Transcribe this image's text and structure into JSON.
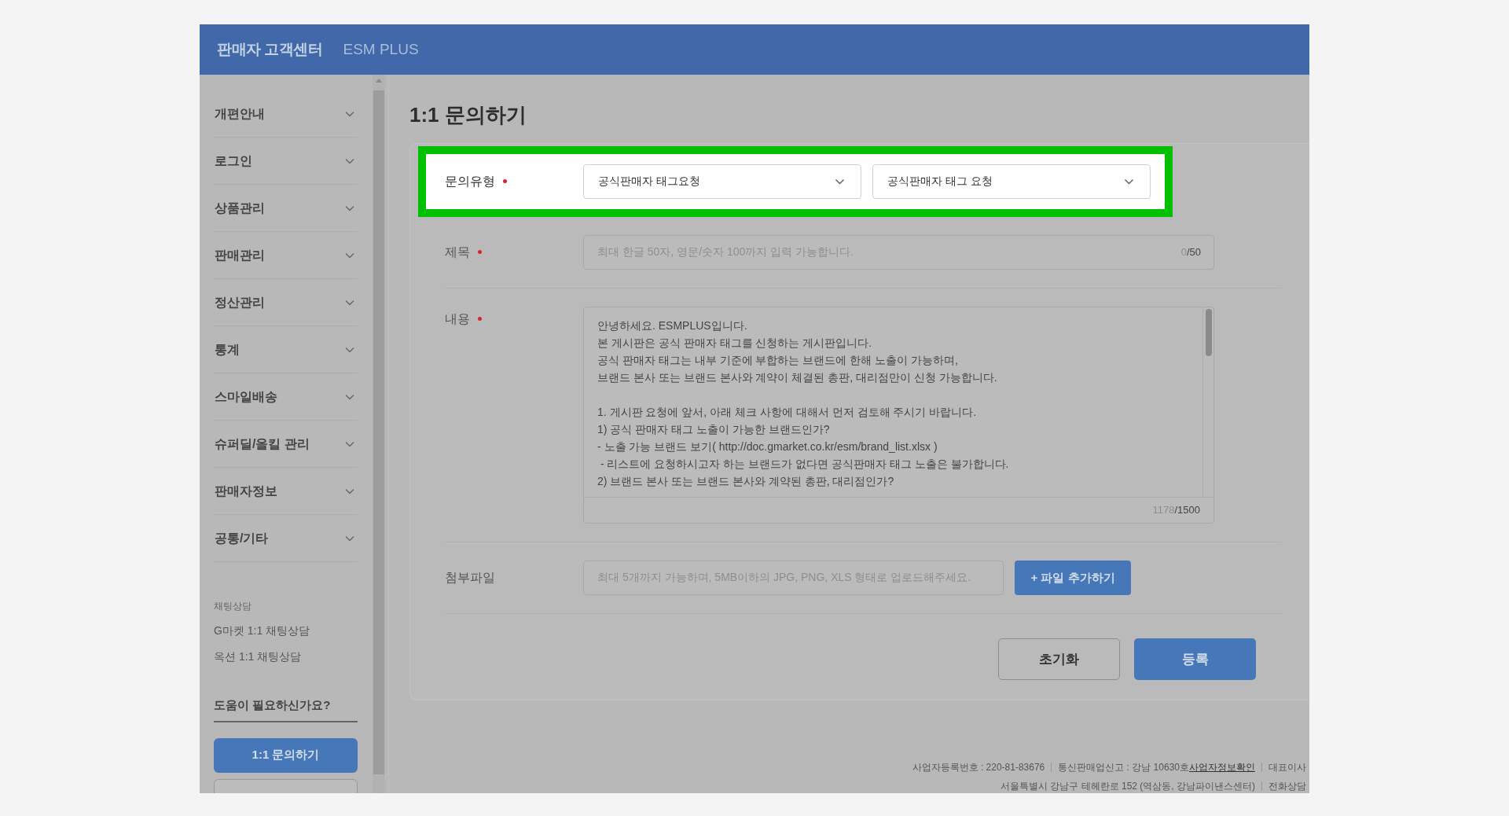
{
  "header": {
    "title": "판매자 고객센터",
    "brand": "ESM PLUS"
  },
  "sidebar": {
    "items": [
      {
        "label": "개편안내",
        "expanded": false
      },
      {
        "label": "로그인",
        "expanded": false
      },
      {
        "label": "상품관리",
        "expanded": false
      },
      {
        "label": "판매관리",
        "expanded": false
      },
      {
        "label": "정산관리",
        "expanded": false
      },
      {
        "label": "통계",
        "expanded": false
      },
      {
        "label": "스마일배송",
        "expanded": false
      },
      {
        "label": "슈퍼딜/올킬 관리",
        "expanded": false
      },
      {
        "label": "판매자정보",
        "expanded": false
      },
      {
        "label": "공통/기타",
        "expanded": false
      }
    ],
    "chat_title": "채팅상담",
    "chat_links": [
      "G마켓 1:1 채팅상담",
      "옥션 1:1 채팅상담"
    ],
    "help_title": "도움이 필요하신가요?",
    "buttons": [
      {
        "label": "1:1 문의하기",
        "selected": true
      }
    ]
  },
  "page_title": "1:1 문의하기",
  "form": [
    {
      "kind": "select",
      "label": "문의유형",
      "required": true,
      "highlighted": true,
      "values": [
        "공식판매자 태그요청",
        "공식판매자 태그 요청"
      ]
    },
    {
      "kind": "text",
      "label": "제목",
      "required": true,
      "highlighted": false,
      "placeholder": "최대 한글 50자, 영문/숫자 100까지 입력 가능합니다.",
      "count": "0",
      "max": "/50"
    },
    {
      "kind": "textarea",
      "label": "내용",
      "required": true,
      "highlighted": false,
      "paragraphs": [
        [
          "안녕하세요. ESMPLUS입니다.",
          "본 게시판은 공식 판매자 태그를 신청하는 게시판입니다.",
          "공식 판매자 태그는 내부 기준에 부합하는 브랜드에 한해 노출이 가능하며,",
          "브랜드 본사 또는 브랜드 본사와 계약이 체결된 총판, 대리점만이 신청 가능합니다."
        ],
        [
          "1. 게시판 요청에 앞서, 아래 체크 사항에 대해서 먼저 검토해 주시기 바랍니다.",
          "1) 공식 판매자 태그 노출이 가능한 브랜드인가?",
          "- 노출 가능 브랜드 보기( http://doc.gmarket.co.kr/esm/brand_list.xlsx )",
          " - 리스트에 요청하시고자 하는 브랜드가 없다면 공식판매자 태그 노출은 불가합니다.",
          "2) 브랜드 본사 또는 브랜드 본사와 계약된 총판, 대리점인가?"
        ]
      ],
      "count": "1178",
      "max": "/1500"
    },
    {
      "kind": "file",
      "label": "첨부파일",
      "required": false,
      "highlighted": false,
      "placeholder": "최대 5개까지 가능하며, 5MB이하의 JPG, PNG, XLS 형태로 업로드해주세요.",
      "button": "+ 파일 추가하기"
    }
  ],
  "actions": [
    {
      "label": "초기화",
      "primary": false
    },
    {
      "label": "등록",
      "primary": true
    }
  ],
  "footer": [
    [
      {
        "kind": "text",
        "text": "사업자등록번호 : 220-81-83676"
      },
      {
        "kind": "text",
        "text": "통신판매업신고 : 강남 10630호",
        "link": "사업자정보확인"
      },
      {
        "kind": "text",
        "text": "대표이사"
      }
    ],
    [
      {
        "kind": "text",
        "text": "서울특별시 강남구 테헤란로 152 (역삼동, 강남파이낸스센터)"
      },
      {
        "kind": "text",
        "text": "전화상담"
      }
    ]
  ]
}
